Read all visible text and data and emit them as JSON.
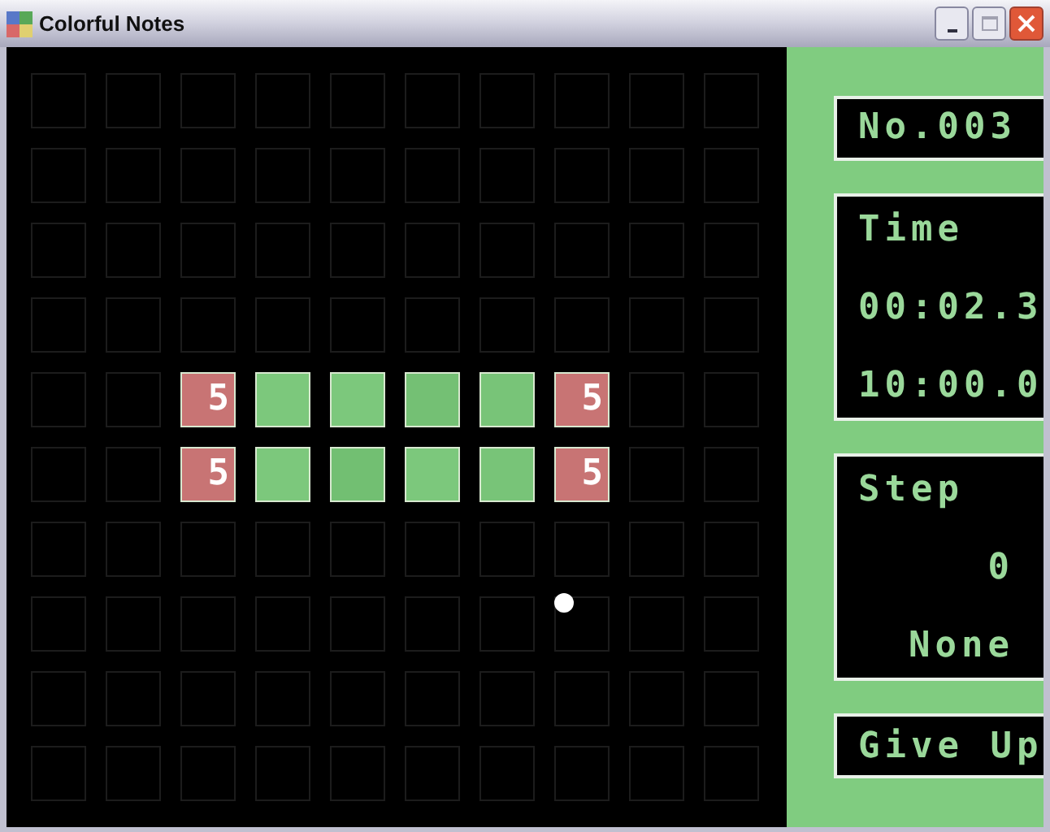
{
  "window": {
    "title": "Colorful Notes"
  },
  "board": {
    "rows": [
      [
        {
          "kind": "empty"
        },
        {
          "kind": "empty"
        },
        {
          "kind": "empty"
        },
        {
          "kind": "empty"
        },
        {
          "kind": "empty"
        },
        {
          "kind": "empty"
        },
        {
          "kind": "empty"
        },
        {
          "kind": "empty"
        },
        {
          "kind": "empty"
        },
        {
          "kind": "empty"
        }
      ],
      [
        {
          "kind": "empty"
        },
        {
          "kind": "empty"
        },
        {
          "kind": "empty"
        },
        {
          "kind": "empty"
        },
        {
          "kind": "empty"
        },
        {
          "kind": "empty"
        },
        {
          "kind": "empty"
        },
        {
          "kind": "empty"
        },
        {
          "kind": "empty"
        },
        {
          "kind": "empty"
        }
      ],
      [
        {
          "kind": "empty"
        },
        {
          "kind": "empty"
        },
        {
          "kind": "empty"
        },
        {
          "kind": "empty"
        },
        {
          "kind": "empty"
        },
        {
          "kind": "empty"
        },
        {
          "kind": "empty"
        },
        {
          "kind": "empty"
        },
        {
          "kind": "empty"
        },
        {
          "kind": "empty"
        }
      ],
      [
        {
          "kind": "empty"
        },
        {
          "kind": "empty"
        },
        {
          "kind": "empty"
        },
        {
          "kind": "empty"
        },
        {
          "kind": "empty"
        },
        {
          "kind": "empty"
        },
        {
          "kind": "empty"
        },
        {
          "kind": "empty"
        },
        {
          "kind": "empty"
        },
        {
          "kind": "empty"
        }
      ],
      [
        {
          "kind": "empty"
        },
        {
          "kind": "empty"
        },
        {
          "kind": "note",
          "color": "#c87474",
          "text": "5"
        },
        {
          "kind": "note",
          "color": "#7cc87c"
        },
        {
          "kind": "note",
          "color": "#7cc87c"
        },
        {
          "kind": "note",
          "color": "#74c074"
        },
        {
          "kind": "note",
          "color": "#78c478"
        },
        {
          "kind": "note",
          "color": "#c87474",
          "text": "5"
        },
        {
          "kind": "empty"
        },
        {
          "kind": "empty"
        }
      ],
      [
        {
          "kind": "empty"
        },
        {
          "kind": "empty"
        },
        {
          "kind": "note",
          "color": "#c87474",
          "text": "5"
        },
        {
          "kind": "note",
          "color": "#7cc87c"
        },
        {
          "kind": "note",
          "color": "#72bf72"
        },
        {
          "kind": "note",
          "color": "#7cc87c"
        },
        {
          "kind": "note",
          "color": "#78c478"
        },
        {
          "kind": "note",
          "color": "#c87474",
          "text": "5"
        },
        {
          "kind": "empty"
        },
        {
          "kind": "empty"
        }
      ],
      [
        {
          "kind": "empty"
        },
        {
          "kind": "empty"
        },
        {
          "kind": "empty"
        },
        {
          "kind": "empty"
        },
        {
          "kind": "empty"
        },
        {
          "kind": "empty"
        },
        {
          "kind": "empty"
        },
        {
          "kind": "empty"
        },
        {
          "kind": "empty"
        },
        {
          "kind": "empty"
        }
      ],
      [
        {
          "kind": "empty"
        },
        {
          "kind": "empty"
        },
        {
          "kind": "empty"
        },
        {
          "kind": "empty"
        },
        {
          "kind": "empty"
        },
        {
          "kind": "empty"
        },
        {
          "kind": "empty"
        },
        {
          "kind": "empty"
        },
        {
          "kind": "empty"
        },
        {
          "kind": "empty"
        }
      ],
      [
        {
          "kind": "empty"
        },
        {
          "kind": "empty"
        },
        {
          "kind": "empty"
        },
        {
          "kind": "empty"
        },
        {
          "kind": "empty"
        },
        {
          "kind": "empty"
        },
        {
          "kind": "empty"
        },
        {
          "kind": "empty"
        },
        {
          "kind": "empty"
        },
        {
          "kind": "empty"
        }
      ],
      [
        {
          "kind": "empty"
        },
        {
          "kind": "empty"
        },
        {
          "kind": "empty"
        },
        {
          "kind": "empty"
        },
        {
          "kind": "empty"
        },
        {
          "kind": "empty"
        },
        {
          "kind": "empty"
        },
        {
          "kind": "empty"
        },
        {
          "kind": "empty"
        },
        {
          "kind": "empty"
        }
      ]
    ]
  },
  "panel": {
    "number": "No.003",
    "time": {
      "label": "Time",
      "elapsed": "00:02.3",
      "limit": "10:00.0"
    },
    "step": {
      "label": "Step",
      "count": "0",
      "combo": "None"
    },
    "give_up_button": "Give Up"
  }
}
